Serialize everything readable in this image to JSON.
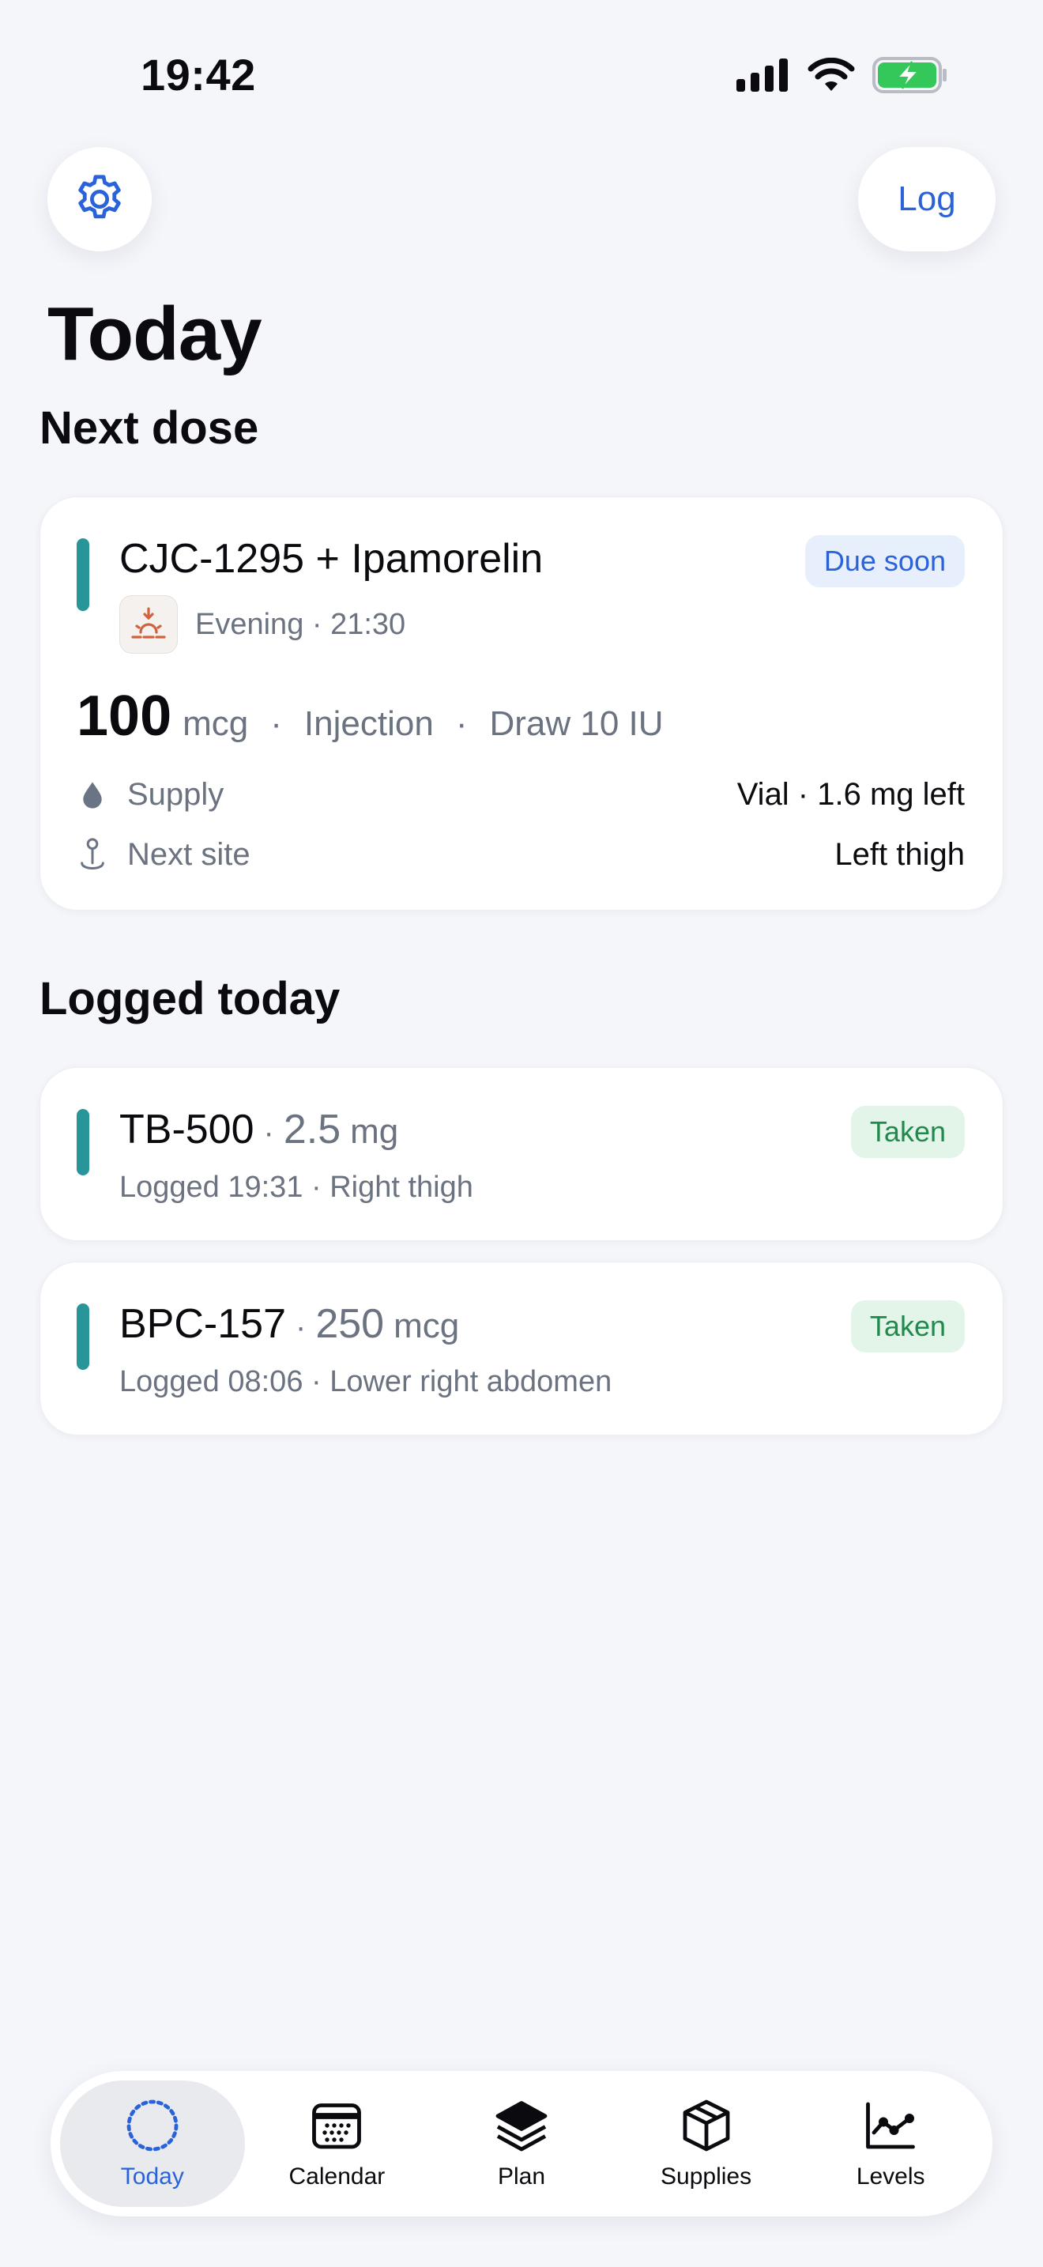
{
  "status_bar": {
    "time": "19:42"
  },
  "top_bar": {
    "log_label": "Log"
  },
  "page_title": "Today",
  "next_dose": {
    "section_title": "Next dose",
    "name": "CJC-1295 + Ipamorelin",
    "badge": "Due soon",
    "time_of_day": "Evening · 21:30",
    "amount": "100",
    "unit": "mcg",
    "route": "Injection",
    "draw": "Draw 10 IU",
    "supply_label": "Supply",
    "supply_value": "Vial · 1.6 mg left",
    "site_label": "Next site",
    "site_value": "Left thigh",
    "accent_color": "#27959a"
  },
  "logged": {
    "section_title": "Logged today",
    "items": [
      {
        "name": "TB-500",
        "amount": "2.5",
        "unit": "mg",
        "detail": "Logged 19:31 · Right thigh",
        "badge": "Taken"
      },
      {
        "name": "BPC-157",
        "amount": "250",
        "unit": "mcg",
        "detail": "Logged 08:06 · Lower right abdomen",
        "badge": "Taken"
      }
    ]
  },
  "tabs": [
    {
      "label": "Today",
      "icon": "today-icon",
      "active": true
    },
    {
      "label": "Calendar",
      "icon": "calendar-icon"
    },
    {
      "label": "Plan",
      "icon": "layers-icon"
    },
    {
      "label": "Supplies",
      "icon": "box-icon"
    },
    {
      "label": "Levels",
      "icon": "chart-line-icon"
    }
  ],
  "colors": {
    "accent_blue": "#2a63d9",
    "teal": "#27959a",
    "taken_green": "#1f8a4c",
    "background": "#f5f6fa"
  }
}
